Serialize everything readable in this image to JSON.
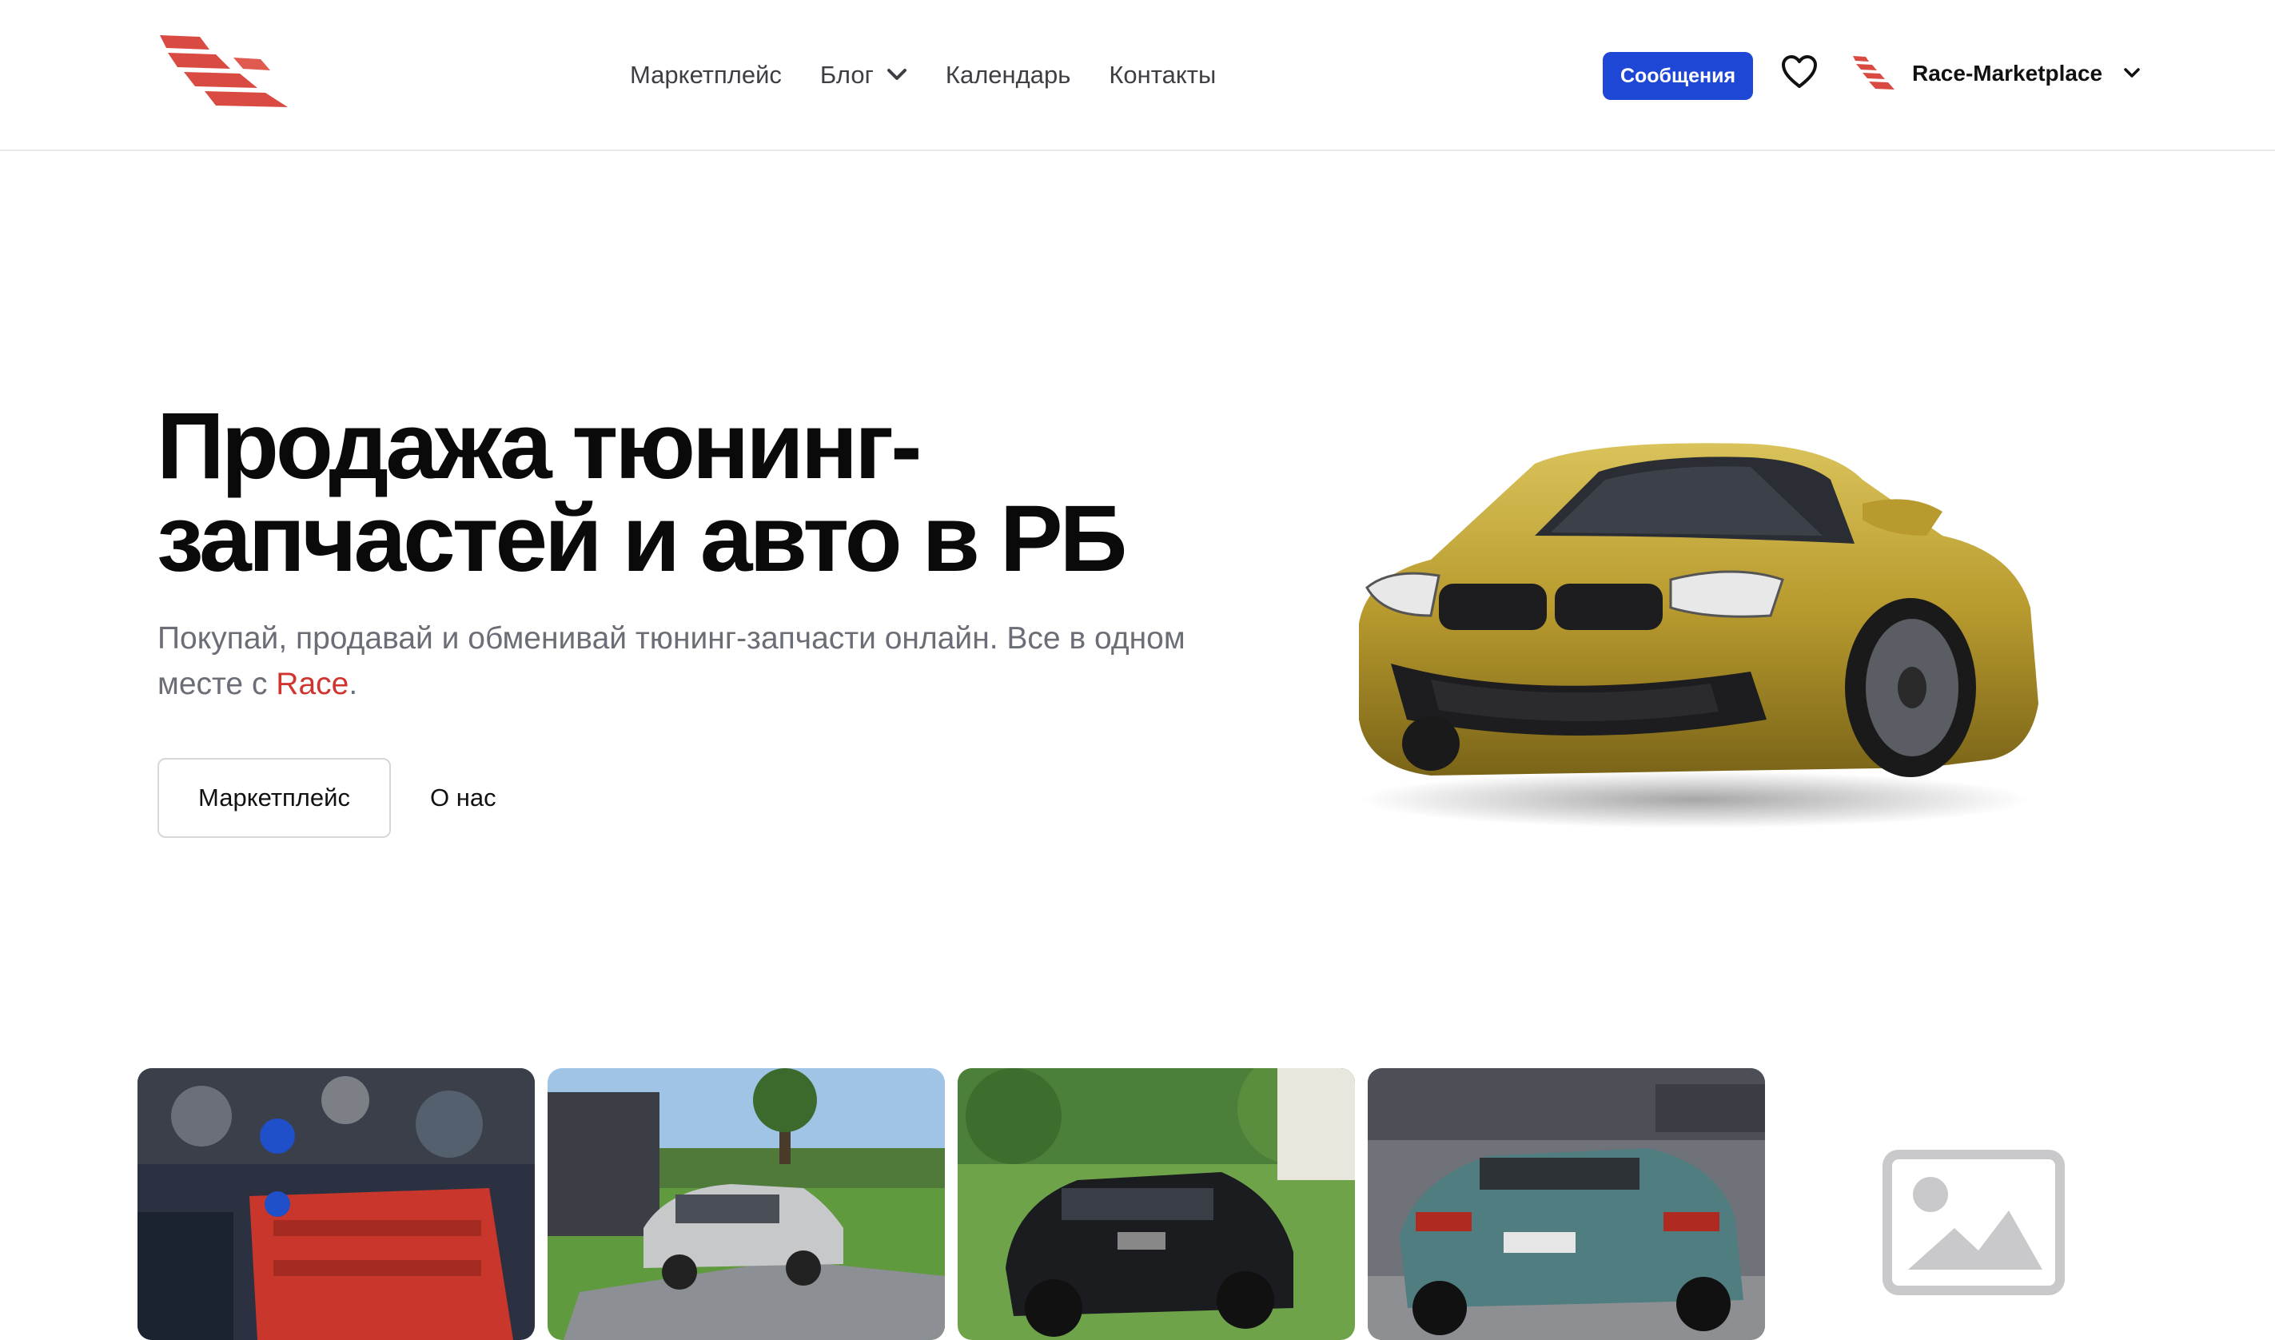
{
  "header": {
    "nav": [
      {
        "label": "Маркетплейс"
      },
      {
        "label": "Блог",
        "has_dropdown": true
      },
      {
        "label": "Календарь"
      },
      {
        "label": "Контакты"
      }
    ],
    "messages_button": "Сообщения",
    "favorites_icon": "heart-icon",
    "profile_name": "Race-Marketplace"
  },
  "hero": {
    "title_line1": "Продажа тюнинг-",
    "title_line2": "запчастей и авто в РБ",
    "subtitle_main": "Покупай, продавай и обменивай тюнинг-запчасти онлайн. Все в одном месте с ",
    "subtitle_brand": "Race",
    "subtitle_end": ".",
    "primary_button": "Маркетплейс",
    "secondary_button": "О нас",
    "image": "yellow-sports-car"
  },
  "gallery": {
    "items": [
      {
        "image": "engine-bay-red-valve-cover"
      },
      {
        "image": "silver-sedan-on-lawn"
      },
      {
        "image": "black-wagon-on-grass"
      },
      {
        "image": "teal-coupe-rear-view"
      },
      {
        "image": "image-placeholder-icon"
      }
    ]
  },
  "colors": {
    "brand_red": "#d1342e",
    "primary_blue": "#1f47d6",
    "subtitle_gray": "#6b6e76"
  }
}
